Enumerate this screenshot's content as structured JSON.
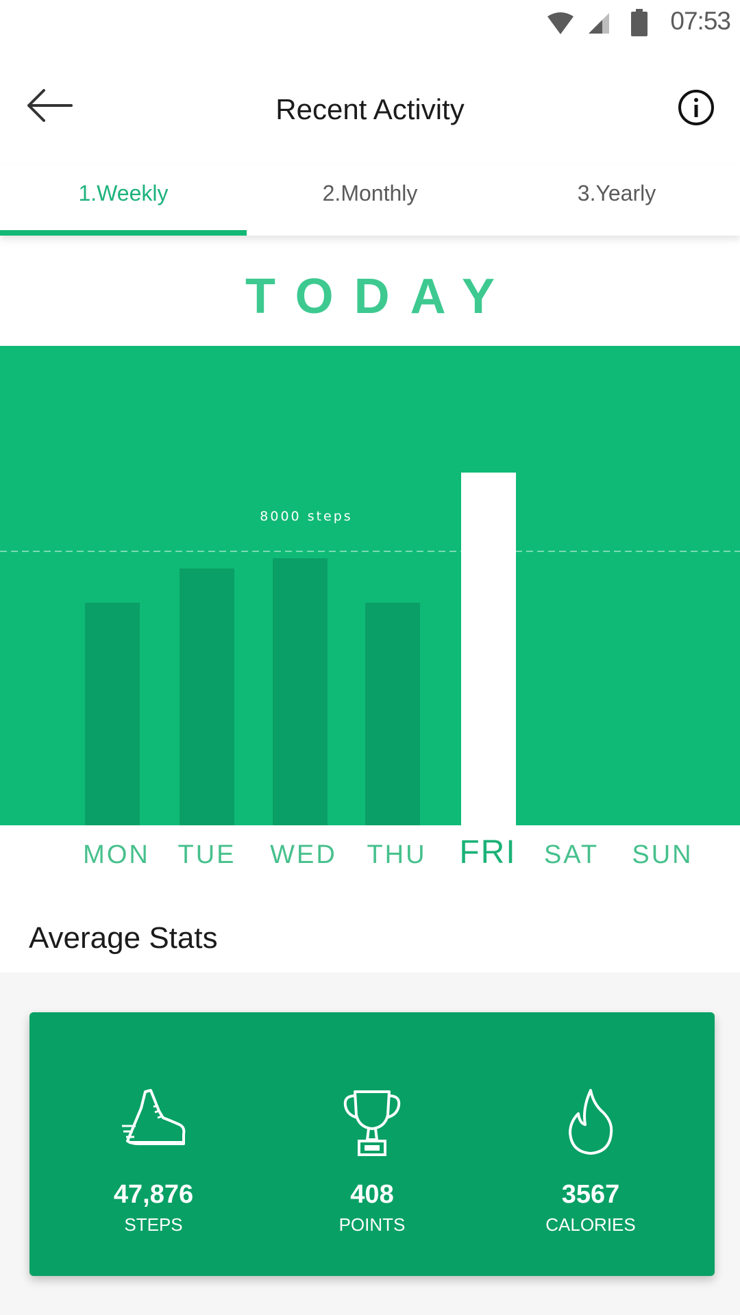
{
  "status_bar": {
    "time": "07:53",
    "icons": [
      "wifi-icon",
      "signal-icon",
      "battery-icon"
    ]
  },
  "header": {
    "title": "Recent Activity",
    "back_icon": "arrow-left-icon",
    "info_icon": "info-icon"
  },
  "tabs": [
    {
      "label": "1.Weekly",
      "active": true
    },
    {
      "label": "2.Monthly",
      "active": false
    },
    {
      "label": "3.Yearly",
      "active": false
    }
  ],
  "today_label": "TODAY",
  "chart_data": {
    "type": "bar",
    "categories": [
      "MON",
      "TUE",
      "WED",
      "THU",
      "FRI",
      "SAT",
      "SUN"
    ],
    "values": [
      6500,
      7500,
      7800,
      6500,
      10300,
      0,
      0
    ],
    "highlight_index": 4,
    "reference_line": {
      "value": 8000,
      "label": "8000 steps"
    },
    "ylim": [
      0,
      14000
    ],
    "colors": {
      "background": "#0fba76",
      "bar": "#0a9f66",
      "highlight": "#ffffff"
    }
  },
  "average_stats": {
    "title": "Average Stats",
    "items": [
      {
        "icon": "sneaker-icon",
        "value": "47,876",
        "label": "STEPS"
      },
      {
        "icon": "trophy-icon",
        "value": "408",
        "label": "POINTS"
      },
      {
        "icon": "flame-icon",
        "value": "3567",
        "label": "CALORIES"
      }
    ]
  },
  "colors": {
    "accent": "#12b875",
    "card": "#08a065"
  }
}
